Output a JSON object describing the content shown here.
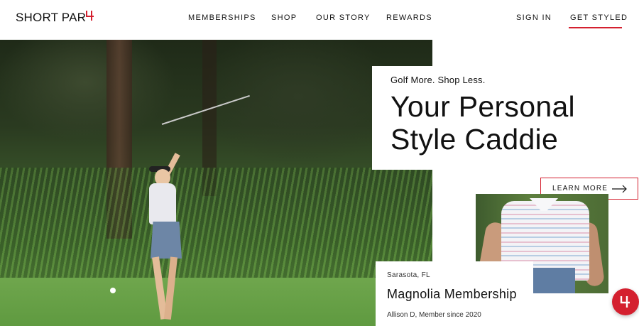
{
  "header": {
    "logo_text": "SHORT PAR",
    "logo_mark": "4",
    "nav": [
      {
        "label": "MEMBERSHIPS"
      },
      {
        "label": "SHOP"
      },
      {
        "label": "OUR STORY"
      },
      {
        "label": "REWARDS"
      }
    ],
    "sign_in": "SIGN IN",
    "get_styled": "GET STYLED"
  },
  "hero": {
    "tagline": "Golf More. Shop Less.",
    "headline": "Your Personal Style Caddie",
    "cta": "LEARN MORE"
  },
  "membership_card": {
    "location": "Sarasota, FL",
    "title": "Magnolia Membership",
    "member_line": "Allison D, Member since 2020"
  },
  "colors": {
    "accent": "#d4202f",
    "text": "#111111",
    "background": "#ffffff"
  },
  "icons": {
    "logo_mark": "par4-logo-icon",
    "cta_arrow": "arrow-right-icon",
    "chat": "chat-par4-icon"
  }
}
